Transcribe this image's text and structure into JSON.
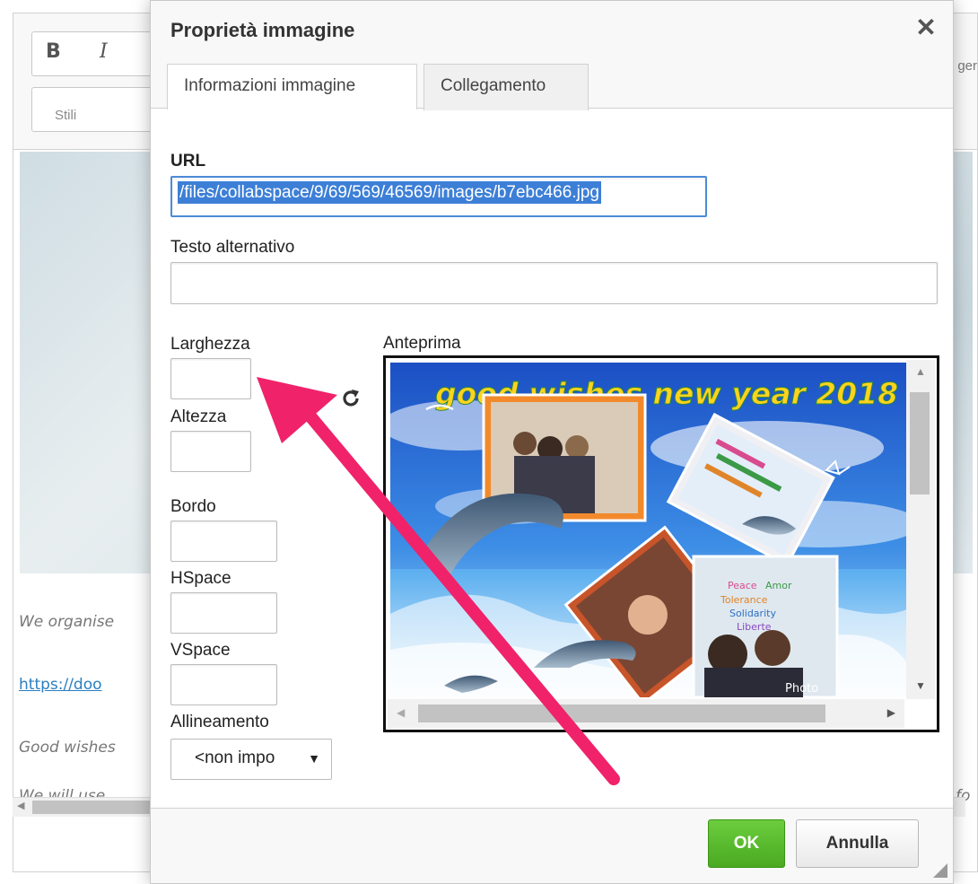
{
  "editor": {
    "toolbar": {
      "bold_label": "B",
      "italic_label": "I",
      "styles_label": "Stili",
      "right_fragment": "ger"
    },
    "content": {
      "line1": "We organise",
      "link": "https://doo",
      "line3": "Good wishes",
      "line4": "We will use",
      "line4_right": "fo"
    }
  },
  "dialog": {
    "title": "Proprietà immagine",
    "close_label": "✕",
    "tabs": [
      {
        "label": "Informazioni immagine",
        "active": true
      },
      {
        "label": "Collegamento",
        "active": false
      }
    ],
    "fields": {
      "url_label": "URL",
      "url_value": "/files/collabspace/9/69/569/46569/images/b7ebc466.jpg",
      "alt_label": "Testo alternativo",
      "alt_value": "",
      "width_label": "Larghezza",
      "width_value": "",
      "height_label": "Altezza",
      "height_value": "",
      "border_label": "Bordo",
      "border_value": "",
      "hspace_label": "HSpace",
      "hspace_value": "",
      "vspace_label": "VSpace",
      "vspace_value": "",
      "align_label": "Allineamento",
      "align_selected": "<non impo"
    },
    "preview": {
      "label": "Anteprima",
      "image_text": {
        "headline": "good wishes new year 2018",
        "photo_tag": "Photo",
        "board_words": [
          "Peace",
          "Amor",
          "Tolerance",
          "Solidarity",
          "Liberte"
        ]
      }
    },
    "footer": {
      "ok_label": "OK",
      "cancel_label": "Annulla"
    }
  },
  "annotation": {
    "arrow_color": "#f0226a"
  },
  "colors": {
    "ok_green": "#4aa920",
    "focus_blue": "#4c8bd8",
    "selection_blue": "#3d7fd6"
  }
}
